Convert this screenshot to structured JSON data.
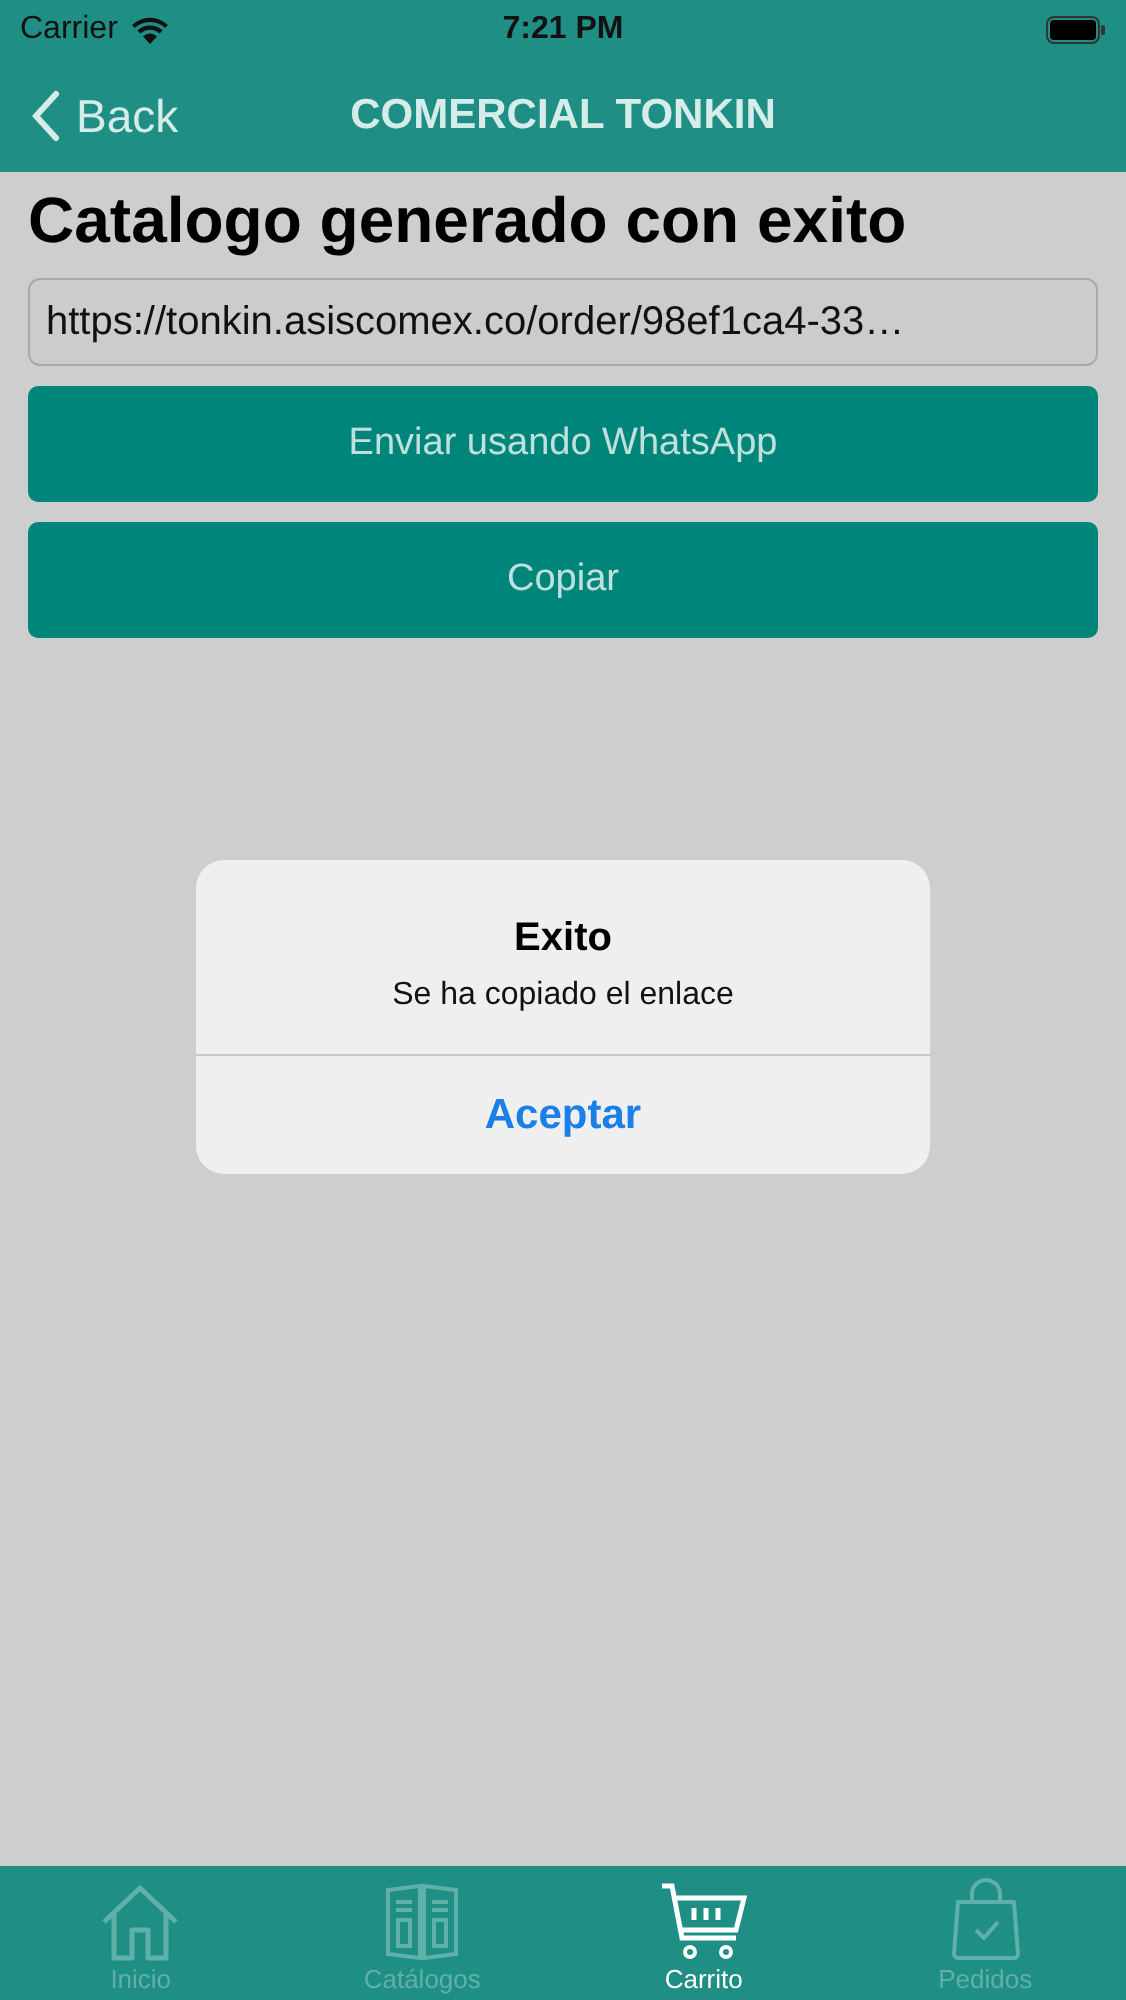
{
  "status_bar": {
    "carrier": "Carrier",
    "time": "7:21 PM"
  },
  "nav_bar": {
    "back": "Back",
    "title": "COMERCIAL TONKIN"
  },
  "heading": "Catalogo generado con exito",
  "link_field": {
    "value": "https://tonkin.asiscomex.co/order/98ef1ca4-33…"
  },
  "buttons": [
    "Enviar usando WhatsApp",
    "Copiar"
  ],
  "alert": {
    "title": "Exito",
    "message": "Se ha copiado el enlace",
    "button": "Aceptar"
  },
  "tabs": [
    {
      "label": "Inicio",
      "kind": "home",
      "selected": false
    },
    {
      "label": "Catálogos",
      "kind": "catalog",
      "selected": false
    },
    {
      "label": "Carrito",
      "kind": "cart",
      "selected": true
    },
    {
      "label": "Pedidos",
      "kind": "bag",
      "selected": false
    }
  ]
}
